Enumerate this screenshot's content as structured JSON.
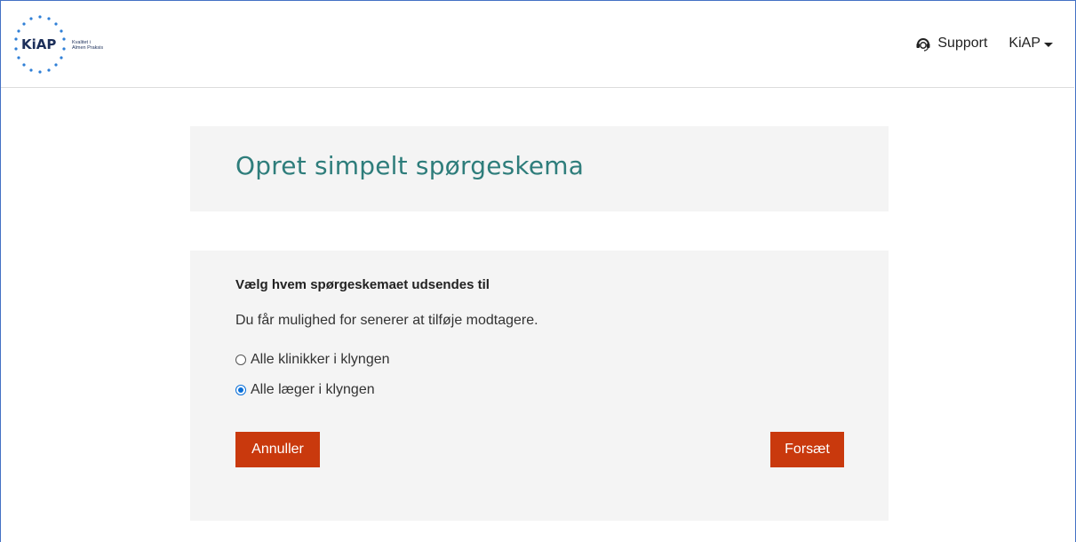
{
  "header": {
    "logo_text": "KiAP",
    "logo_subtitle_line1": "Kvalitet i",
    "logo_subtitle_line2": "Almen Praksis",
    "support_label": "Support",
    "user_menu_label": "KiAP"
  },
  "title_panel": {
    "title": "Opret simpelt spørgeskema"
  },
  "form": {
    "heading": "Vælg hvem spørgeskemaet udsendes til",
    "description": "Du får mulighed for senerer at tilføje modtagere.",
    "options": [
      {
        "label": "Alle klinikker i klyngen",
        "selected": false
      },
      {
        "label": "Alle læger i klyngen",
        "selected": true
      }
    ],
    "cancel_label": "Annuller",
    "continue_label": "Forsæt"
  },
  "colors": {
    "accent_title": "#2e7d7b",
    "button_bg": "#c9390d",
    "logo_dots": "#2f7fd6",
    "panel_bg": "#f4f4f4"
  }
}
